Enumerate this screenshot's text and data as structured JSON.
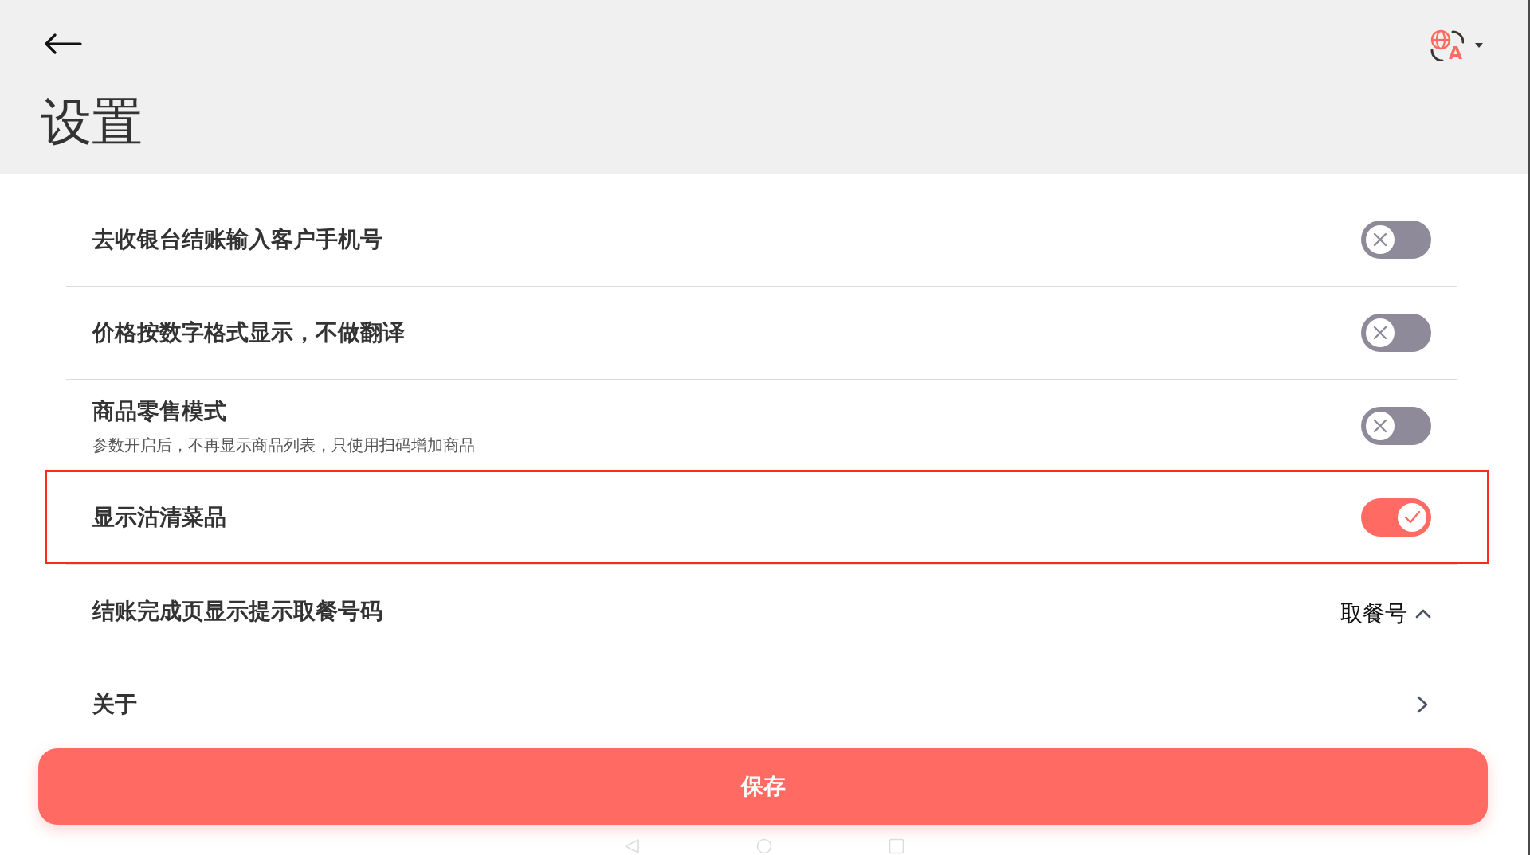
{
  "header": {
    "title": "设置",
    "language_button": {
      "letter": "A"
    }
  },
  "settings": [
    {
      "kind": "toggle",
      "label": "去收银台结账输入客户手机号",
      "on": false,
      "highlighted": false
    },
    {
      "kind": "toggle",
      "label": "价格按数字格式显示，不做翻译",
      "on": false,
      "highlighted": false
    },
    {
      "kind": "toggle",
      "label": "商品零售模式",
      "description": "参数开启后，不再显示商品列表，只使用扫码增加商品",
      "on": false,
      "highlighted": false
    },
    {
      "kind": "toggle",
      "label": "显示沽清菜品",
      "on": true,
      "highlighted": true
    },
    {
      "kind": "select",
      "label": "结账完成页显示提示取餐号码",
      "value": "取餐号",
      "expanded": true,
      "highlighted": false
    },
    {
      "kind": "link",
      "label": "关于",
      "highlighted": false
    }
  ],
  "save_button": {
    "label": "保存"
  }
}
